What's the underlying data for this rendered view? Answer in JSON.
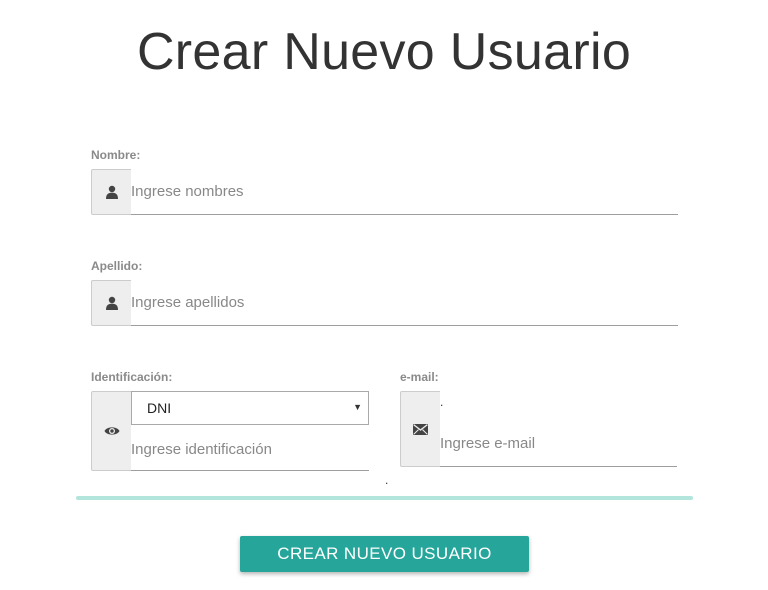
{
  "page": {
    "title": "Crear Nuevo Usuario"
  },
  "form": {
    "nombre": {
      "label": "Nombre:",
      "placeholder": "Ingrese nombres",
      "icon": "user-icon",
      "value": ""
    },
    "apellido": {
      "label": "Apellido:",
      "placeholder": "Ingrese apellidos",
      "icon": "user-icon",
      "value": ""
    },
    "identificacion": {
      "label": "Identificación:",
      "icon": "eye-icon",
      "type_selected": "DNI",
      "placeholder": "Ingrese identificación",
      "value": "",
      "trailing_mark": "."
    },
    "email": {
      "label": "e-mail:",
      "placeholder": "Ingrese e-mail",
      "icon": "envelope-icon",
      "value": "",
      "leading_mark": "."
    },
    "submit_label": "Crear Nuevo Usuario"
  },
  "colors": {
    "accent": "#26a69a",
    "divider": "#b2e6dc",
    "label": "#8a8a8a",
    "addon_bg": "#eeeeee"
  }
}
